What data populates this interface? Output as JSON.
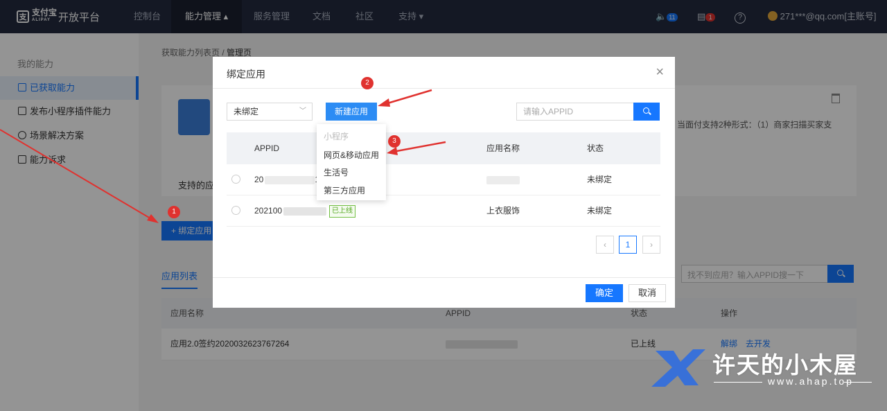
{
  "topbar": {
    "logo_cn": "支付宝",
    "logo_en": "ALIPAY",
    "title": "开放平台",
    "nav": [
      "控制台",
      "能力管理 ▴",
      "服务管理",
      "文档",
      "社区",
      "支持 ▾"
    ],
    "notif_count": "11",
    "msg_count": "1",
    "help": "?",
    "account": "271***@qq.com[主账号]"
  },
  "sidebar": {
    "heading": "我的能力",
    "items": [
      "已获取能力",
      "发布小程序插件能力",
      "场景解决方案",
      "能力诉求"
    ]
  },
  "main": {
    "breadcrumb_parent": "获取能力列表页",
    "breadcrumb_sep": "/",
    "breadcrumb_current": "管理页",
    "card_desc": "当面付支持2种形式：（1）商家扫描买家支",
    "card_support": "支持的应",
    "bind_button": "+ 绑定应用",
    "tab": "应用列表",
    "search_placeholder": "找不到应用？输入APPID搜一下",
    "table": {
      "headers": [
        "应用名称",
        "APPID",
        "状态",
        "操作"
      ],
      "rows": [
        {
          "name": "应用2.0签约2020032623767264",
          "status": "已上线",
          "actions": [
            "解绑",
            "去开发"
          ]
        }
      ]
    }
  },
  "modal": {
    "title": "绑定应用",
    "close": "×",
    "select_value": "未绑定",
    "new_button": "新建应用",
    "search_placeholder": "请输入APPID",
    "headers": [
      "APPID",
      "应用名称",
      "状态"
    ],
    "rows": [
      {
        "appid_prefix": "20",
        "appid_suffix": "1",
        "name": "",
        "status": "未绑定"
      },
      {
        "appid_prefix": "202100",
        "tag": "已上线",
        "name": "上衣服饰",
        "status": "未绑定"
      }
    ],
    "pagination": {
      "prev": "‹",
      "page": "1",
      "next": "›"
    },
    "ok_button": "确定",
    "cancel_button": "取消"
  },
  "dropdown": {
    "items": [
      "小程序",
      "网页&移动应用",
      "生活号",
      "第三方应用"
    ]
  },
  "annotations": {
    "markers": [
      "1",
      "2",
      "3"
    ],
    "color": "#e0322f"
  },
  "watermark": {
    "title": "许天的小木屋",
    "url": "www.ahap.top"
  }
}
